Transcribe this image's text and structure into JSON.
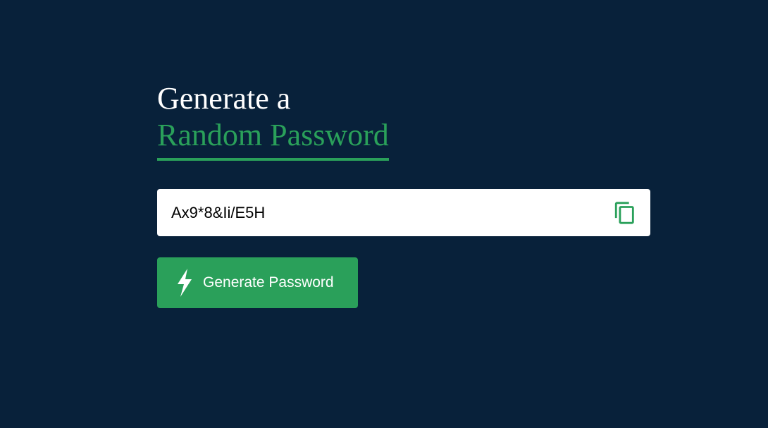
{
  "heading": {
    "line1": "Generate a",
    "line2": "Random Password"
  },
  "password": {
    "value": "Ax9*8&Ii/E5H"
  },
  "icons": {
    "copy": "copy-icon",
    "generate": "lightning-bolt-icon"
  },
  "generate_button": {
    "label": "Generate Password"
  },
  "colors": {
    "background": "#08213a",
    "accent": "#2aa05a",
    "heading_text": "#ffffff",
    "field_background": "#ffffff"
  }
}
